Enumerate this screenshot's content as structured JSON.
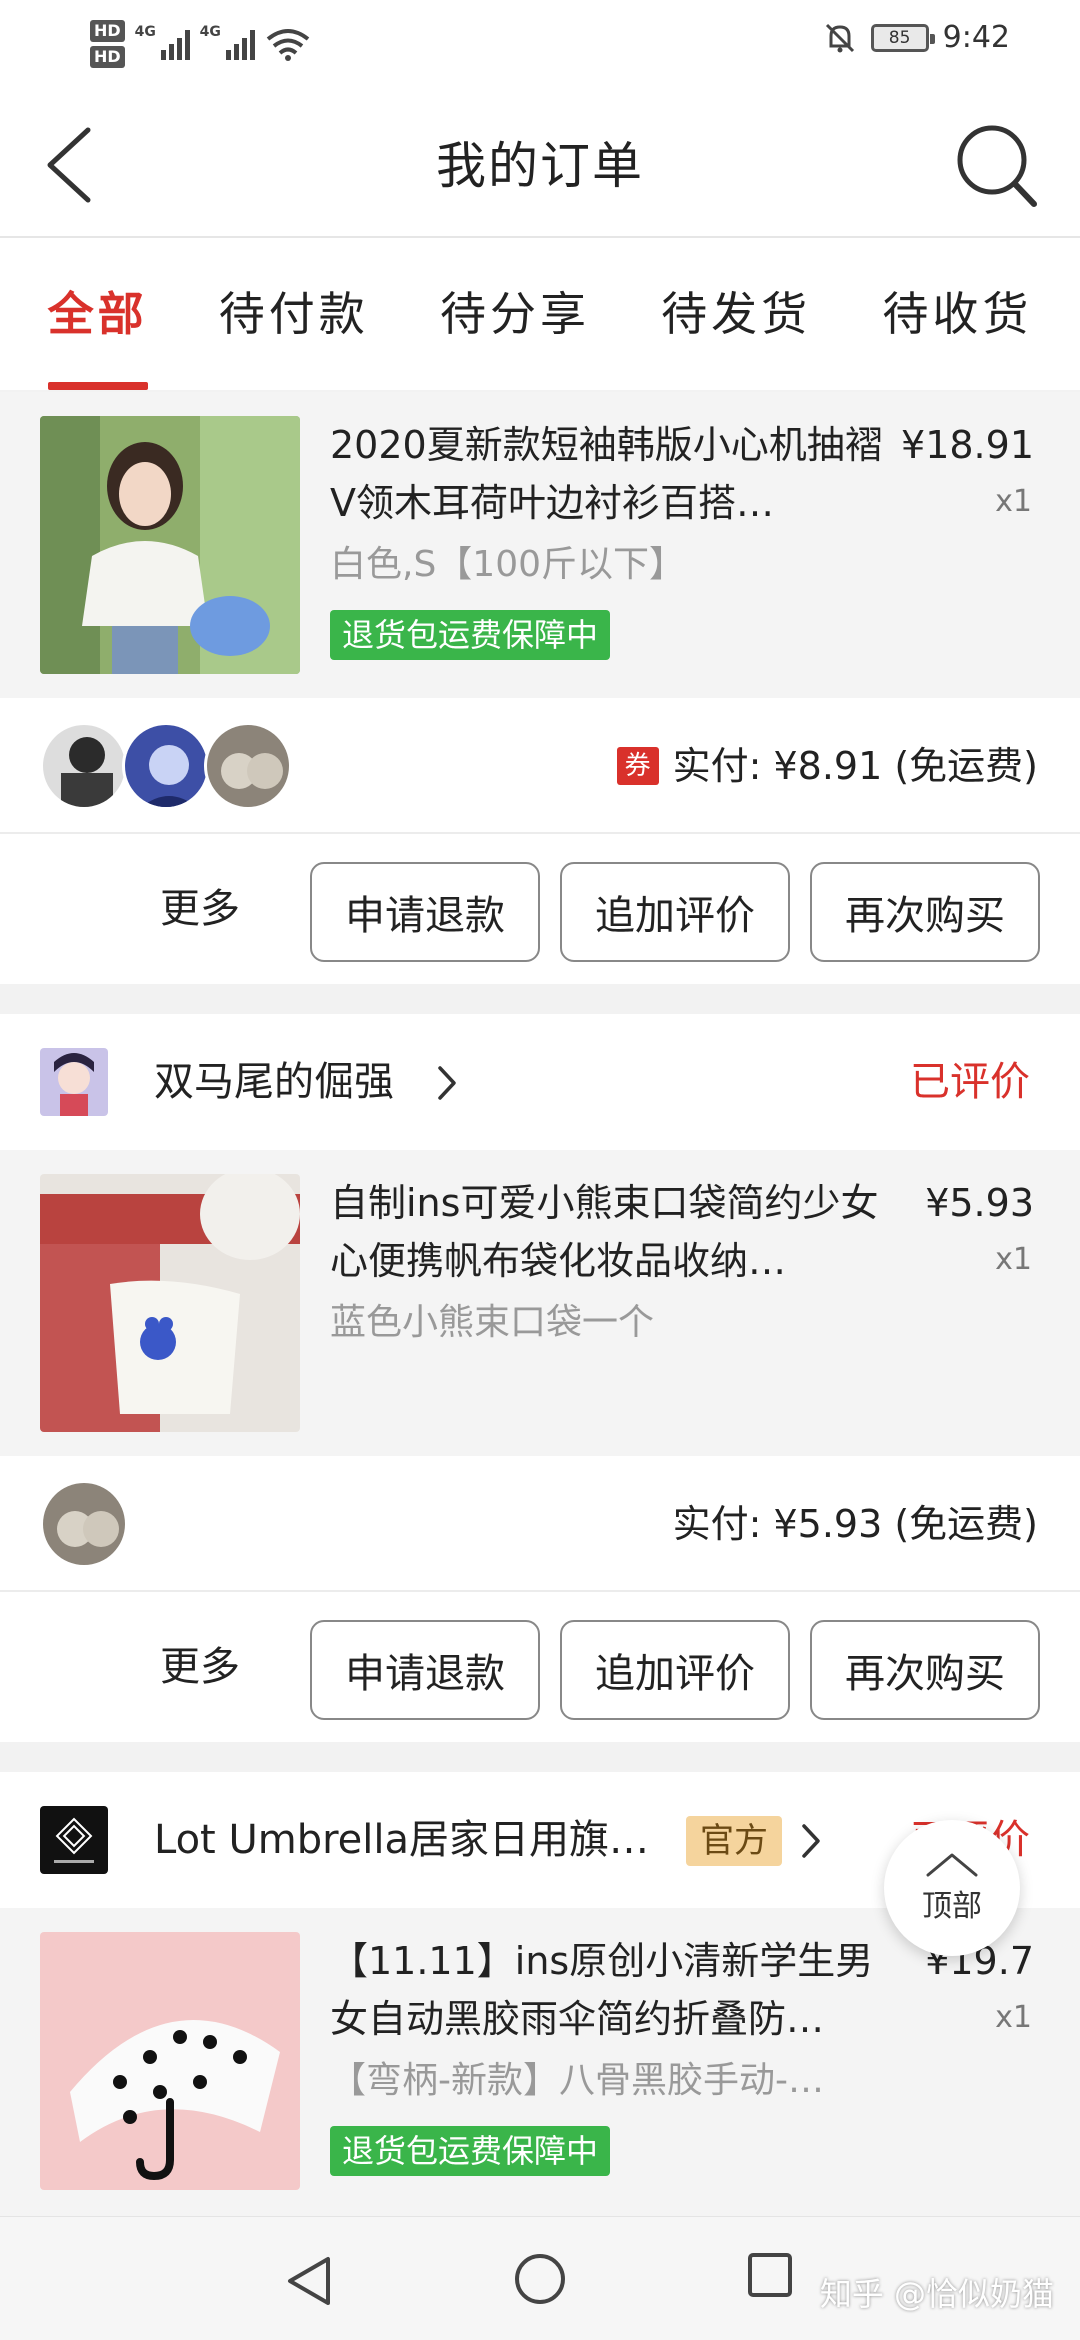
{
  "status_bar": {
    "hd1": "HD",
    "hd2": "HD",
    "net1": "4G",
    "net2": "4G",
    "battery": "85",
    "time": "9:42"
  },
  "header": {
    "title": "我的订单",
    "back_icon": "chevron-left-icon",
    "search_icon": "search-icon"
  },
  "tabs": [
    {
      "label": "全部",
      "active": true
    },
    {
      "label": "待付款",
      "active": false
    },
    {
      "label": "待分享",
      "active": false
    },
    {
      "label": "待发货",
      "active": false
    },
    {
      "label": "待收货",
      "active": false
    }
  ],
  "orders": [
    {
      "item": {
        "title": "2020夏新款短袖韩版小心机抽褶V领木耳荷叶边衬衫百搭…",
        "price": "¥18.91",
        "qty": "x1",
        "spec": "白色,S【100斤以下】",
        "guarantee": "退货包运费保障中"
      },
      "coupon": "券",
      "paid": "实付: ¥8.91 (免运费)",
      "actions": {
        "more": "更多",
        "refund": "申请退款",
        "review": "追加评价",
        "rebuy": "再次购买"
      }
    },
    {
      "shop": {
        "name": "双马尾的倔强",
        "status": "已评价"
      },
      "item": {
        "title": "自制ins可爱小熊束口袋简约少女心便携帆布袋化妆品收纳…",
        "price": "¥5.93",
        "qty": "x1",
        "spec": "蓝色小熊束口袋一个"
      },
      "paid": "实付: ¥5.93 (免运费)",
      "actions": {
        "more": "更多",
        "refund": "申请退款",
        "review": "追加评价",
        "rebuy": "再次购买"
      }
    },
    {
      "shop": {
        "name": "Lot Umbrella居家日用旗…",
        "badge": "官方",
        "status": "已评价"
      },
      "item": {
        "title": "【11.11】ins原创小清新学生男女自动黑胶雨伞简约折叠防…",
        "price": "¥19.7",
        "qty": "x1",
        "spec": "【弯柄-新款】八骨黑胶手动-…",
        "guarantee": "退货包运费保障中"
      }
    }
  ],
  "fab": {
    "label": "顶部",
    "icon": "chevron-up-icon"
  },
  "watermark": "知乎 @恰似奶猫",
  "colors": {
    "accent": "#d9312b",
    "guarantee": "#3ab54a",
    "official_badge": "#f5d49d"
  }
}
